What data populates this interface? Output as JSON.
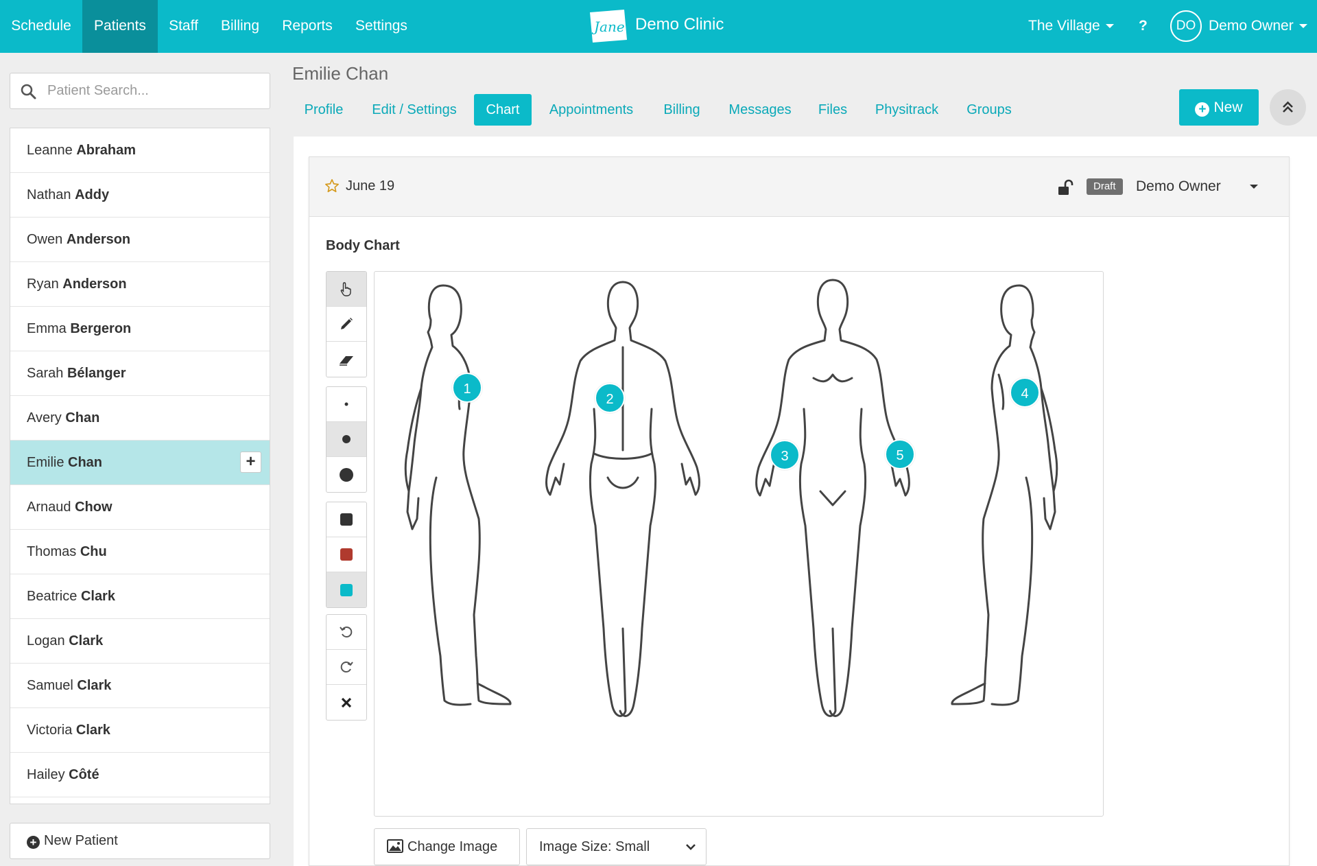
{
  "topbar": {
    "nav": [
      "Schedule",
      "Patients",
      "Staff",
      "Billing",
      "Reports",
      "Settings"
    ],
    "active_nav": "Patients",
    "brand_logo_text": "Jane",
    "clinic_name": "Demo Clinic",
    "location": "The Village",
    "help": "?",
    "avatar_initials": "DO",
    "user_name": "Demo Owner",
    "accent_color": "#0bbac9"
  },
  "sidebar": {
    "search_placeholder": "Patient Search...",
    "patients": [
      {
        "first": "Leanne",
        "last": "Abraham"
      },
      {
        "first": "Nathan",
        "last": "Addy"
      },
      {
        "first": "Owen",
        "last": "Anderson"
      },
      {
        "first": "Ryan",
        "last": "Anderson"
      },
      {
        "first": "Emma",
        "last": "Bergeron"
      },
      {
        "first": "Sarah",
        "last": "Bélanger"
      },
      {
        "first": "Avery",
        "last": "Chan"
      },
      {
        "first": "Emilie",
        "last": "Chan"
      },
      {
        "first": "Arnaud",
        "last": "Chow"
      },
      {
        "first": "Thomas",
        "last": "Chu"
      },
      {
        "first": "Beatrice",
        "last": "Clark"
      },
      {
        "first": "Logan",
        "last": "Clark"
      },
      {
        "first": "Samuel",
        "last": "Clark"
      },
      {
        "first": "Victoria",
        "last": "Clark"
      },
      {
        "first": "Hailey",
        "last": "Côté"
      }
    ],
    "selected_patient": "Emilie Chan",
    "add_symbol": "+",
    "new_patient_label": "New Patient"
  },
  "patient": {
    "name": "Emilie Chan",
    "tabs": [
      "Profile",
      "Edit / Settings",
      "Chart",
      "Appointments",
      "Billing",
      "Messages",
      "Files",
      "Physitrack",
      "Groups"
    ],
    "active_tab": "Chart",
    "new_button_label": "New"
  },
  "chart_entry": {
    "date": "June 19",
    "status_badge": "Draft",
    "owner": "Demo Owner",
    "section_title": "Body Chart",
    "tools": {
      "modes": [
        "pointer-icon",
        "pencil-icon",
        "eraser-icon"
      ],
      "brush_sizes": [
        "small-dot-icon",
        "medium-dot-icon",
        "large-dot-icon"
      ],
      "colors": [
        "#333333",
        "#b03a2e",
        "#0bbac9"
      ],
      "actions": [
        "undo-icon",
        "redo-icon",
        "clear-icon"
      ],
      "active_mode": "pointer-icon",
      "active_size": "medium-dot-icon",
      "active_color": "#0bbac9"
    },
    "markers": [
      "1",
      "2",
      "3",
      "4",
      "5"
    ],
    "change_image_label": "Change Image",
    "image_size_label": "Image Size: Small"
  }
}
